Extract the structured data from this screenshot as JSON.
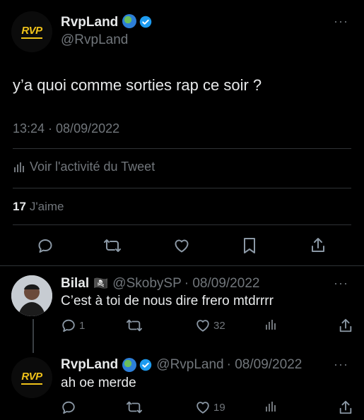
{
  "main_tweet": {
    "author_name": "RvpLand",
    "author_handle": "@RvpLand",
    "logo_text": "RVP",
    "text": "y’a quoi comme sorties rap ce soir ?",
    "timestamp": "13:24 · 08/09/2022",
    "activity_label": "Voir l'activité du Tweet",
    "likes_count": "17",
    "likes_label": "J'aime",
    "more": "···"
  },
  "reply1": {
    "author_name": "Bilal",
    "flag": "🏴‍☠️",
    "author_handle": "@SkobySP",
    "date": "· 08/09/2022",
    "text": "C’est à toi de nous dire frero mtdrrrr",
    "reply_count": "1",
    "retweet_count": "",
    "like_count": "32",
    "more": "···"
  },
  "reply2": {
    "author_name": "RvpLand",
    "logo_text": "RVP",
    "author_handle": "@RvpLand",
    "date": "· 08/09/2022",
    "text": "ah oe merde",
    "reply_count": "",
    "retweet_count": "",
    "like_count": "19",
    "more": "···"
  },
  "colors": {
    "background": "#000000",
    "text": "#e7e9ea",
    "muted": "#71767b",
    "verified": "#1d9bf0",
    "logo": "#f1c31a"
  }
}
